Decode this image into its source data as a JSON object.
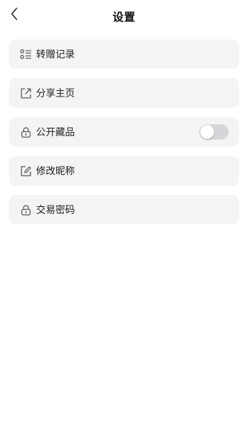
{
  "header": {
    "title": "设置",
    "back_icon": "chevron-left-icon"
  },
  "settings": {
    "items": [
      {
        "label": "转赠记录",
        "icon": "list-icon"
      },
      {
        "label": "分享主页",
        "icon": "share-external-icon"
      },
      {
        "label": "公开藏品",
        "icon": "lock-icon",
        "toggle": {
          "on": false
        }
      },
      {
        "label": "修改昵称",
        "icon": "edit-icon"
      },
      {
        "label": "交易密码",
        "icon": "lock-icon"
      }
    ]
  },
  "colors": {
    "row_background": "#f4f4f5",
    "toggle_off": "#d6d6da",
    "icon_stroke": "#555555"
  }
}
